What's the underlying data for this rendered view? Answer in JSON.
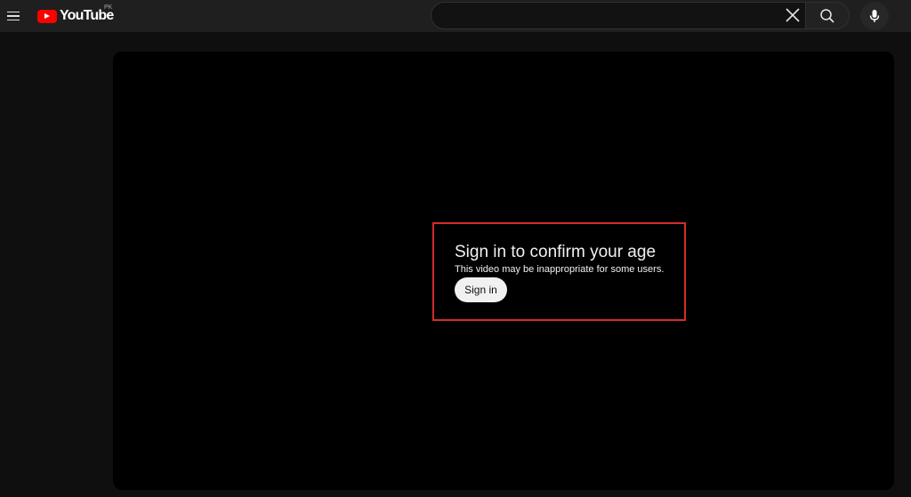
{
  "header": {
    "logo_text": "YouTube",
    "country_code": "PK",
    "search": {
      "value": "",
      "placeholder": ""
    },
    "icons": {
      "menu": "hamburger-menu-icon",
      "clear": "close-icon",
      "search": "search-icon",
      "mic": "microphone-icon"
    }
  },
  "player": {
    "age_gate": {
      "title": "Sign in to confirm your age",
      "subtitle": "This video may be inappropriate for some users.",
      "button_label": "Sign in"
    }
  },
  "colors": {
    "background": "#0f0f0f",
    "topbar": "#1f1f1f",
    "player": "#000000",
    "brand_red": "#ff0000",
    "highlight_border": "#d72a2a",
    "button_bg": "#f1f1f1"
  }
}
